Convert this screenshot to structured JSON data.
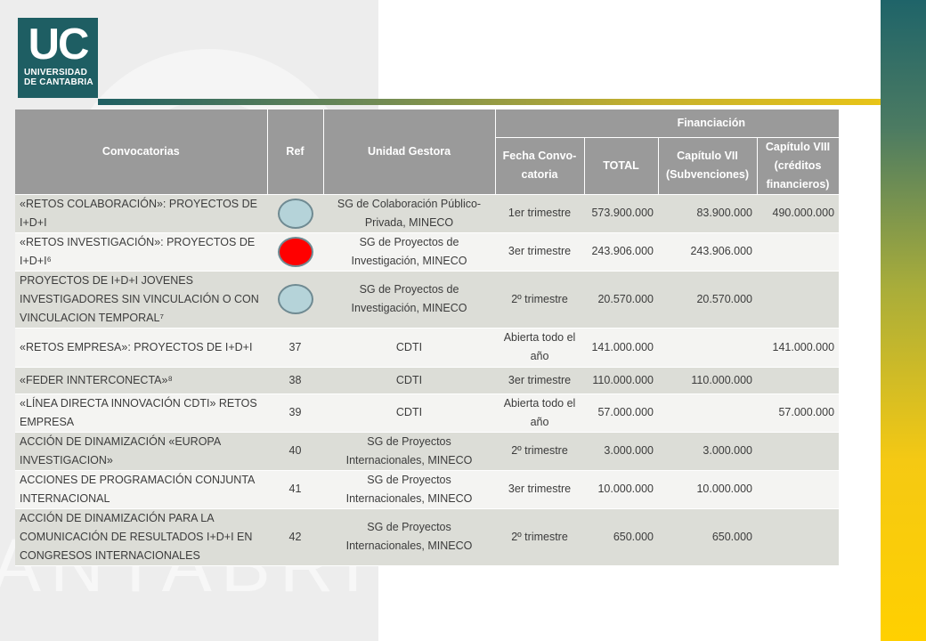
{
  "logo": {
    "initials": "UC",
    "line1": "UNIVERSIDAD",
    "line2": "DE CANTABRIA"
  },
  "watermark": "ANTABRIA",
  "table": {
    "headers": {
      "convocatorias": "Convocatorias",
      "ref": "Ref",
      "unidad": "Unidad Gestora",
      "financiacion": "Financiación",
      "fecha": "Fecha Convo-catoria",
      "total": "TOTAL",
      "cap7": "Capítulo VII (Subvenciones)",
      "cap8": "Capítulo VIII (créditos financieros)"
    },
    "colors": {
      "light_blue": "#b5d3d9",
      "red": "#ff0000"
    },
    "rows": [
      {
        "conv": "«RETOS COLABORACIÓN»: PROYECTOS DE I+D+I",
        "ref": "",
        "dot": "light_blue",
        "unidad": "SG de Colaboración Público-Privada, MINECO",
        "fecha": "1er trimestre",
        "total": "573.900.000",
        "cap7": "83.900.000",
        "cap8": "490.000.000"
      },
      {
        "conv": "«RETOS INVESTIGACIÓN»: PROYECTOS DE I+D+I⁶",
        "ref": "",
        "dot": "red",
        "unidad": "SG de Proyectos de Investigación, MINECO",
        "fecha": "3er trimestre",
        "total": "243.906.000",
        "cap7": "243.906.000",
        "cap8": ""
      },
      {
        "conv": "PROYECTOS DE I+D+I JOVENES INVESTIGADORES SIN VINCULACIÓN O CON VINCULACION TEMPORAL⁷",
        "ref": "",
        "dot": "light_blue",
        "unidad": "SG de Proyectos de Investigación, MINECO",
        "fecha": "2º trimestre",
        "total": "20.570.000",
        "cap7": "20.570.000",
        "cap8": ""
      },
      {
        "conv": "«RETOS EMPRESA»: PROYECTOS DE I+D+I",
        "ref": "37",
        "dot": "",
        "unidad": "CDTI",
        "fecha": "Abierta todo el año",
        "total": "141.000.000",
        "cap7": "",
        "cap8": "141.000.000"
      },
      {
        "conv": "«FEDER INNTERCONECTA»⁸",
        "ref": "38",
        "dot": "",
        "unidad": "CDTI",
        "fecha": "3er trimestre",
        "total": "110.000.000",
        "cap7": "110.000.000",
        "cap8": ""
      },
      {
        "conv": "«LÍNEA DIRECTA INNOVACIÓN CDTI» RETOS EMPRESA",
        "ref": "39",
        "dot": "",
        "unidad": "CDTI",
        "fecha": "Abierta todo el año",
        "total": "57.000.000",
        "cap7": "",
        "cap8": "57.000.000"
      },
      {
        "conv": "ACCIÓN DE DINAMIZACIÓN «EUROPA INVESTIGACION»",
        "ref": "40",
        "dot": "",
        "unidad": "SG de Proyectos Internacionales, MINECO",
        "fecha": "2º trimestre",
        "total": "3.000.000",
        "cap7": "3.000.000",
        "cap8": ""
      },
      {
        "conv": "ACCIONES DE  PROGRAMACIÓN CONJUNTA INTERNACIONAL",
        "ref": "41",
        "dot": "",
        "unidad": "SG de Proyectos Internacionales, MINECO",
        "fecha": "3er trimestre",
        "total": "10.000.000",
        "cap7": "10.000.000",
        "cap8": ""
      },
      {
        "conv": "ACCIÓN DE DINAMIZACIÓN PARA LA COMUNICACIÓN DE RESULTADOS I+D+I EN CONGRESOS INTERNACIONALES",
        "ref": "42",
        "dot": "",
        "unidad": "SG de Proyectos Internacionales, MINECO",
        "fecha": "2º trimestre",
        "total": "650.000",
        "cap7": "650.000",
        "cap8": ""
      }
    ]
  }
}
